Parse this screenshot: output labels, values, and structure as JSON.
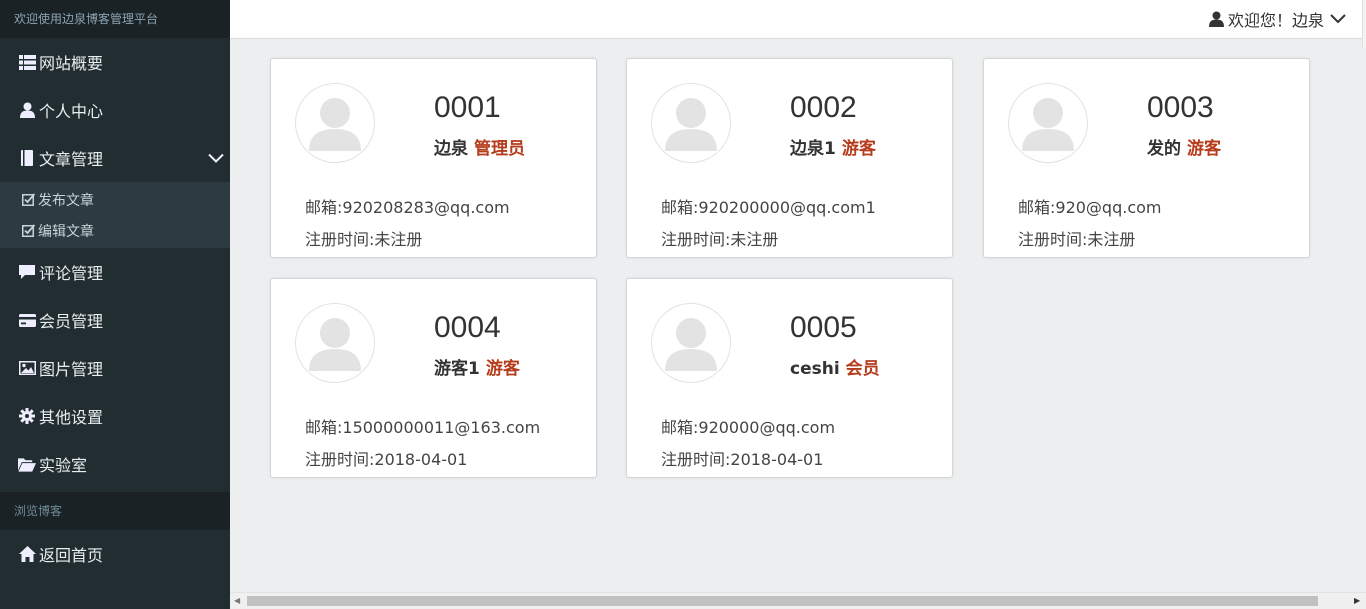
{
  "sidebar": {
    "header": "欢迎使用边泉博客管理平台",
    "items": [
      {
        "label": "网站概要",
        "icon": "list-icon"
      },
      {
        "label": "个人中心",
        "icon": "user-icon"
      },
      {
        "label": "文章管理",
        "icon": "book-icon"
      },
      {
        "label": "评论管理",
        "icon": "comment-icon"
      },
      {
        "label": "会员管理",
        "icon": "card-icon"
      },
      {
        "label": "图片管理",
        "icon": "picture-icon"
      },
      {
        "label": "其他设置",
        "icon": "gear-icon"
      },
      {
        "label": "实验室",
        "icon": "folder-open-icon"
      }
    ],
    "submenu": [
      {
        "label": "发布文章",
        "icon": "edit-icon"
      },
      {
        "label": "编辑文章",
        "icon": "edit-icon"
      }
    ],
    "section_header": "浏览博客",
    "bottom_item": {
      "label": "返回首页",
      "icon": "home-icon"
    }
  },
  "topbar": {
    "welcome": "欢迎您！边泉"
  },
  "cards": [
    {
      "id": "0001",
      "name": "边泉",
      "role": "管理员",
      "email": "邮箱:920208283@qq.com",
      "reg": "注册时间:未注册"
    },
    {
      "id": "0002",
      "name": "边泉1",
      "role": "游客",
      "email": "邮箱:920200000@qq.com1",
      "reg": "注册时间:未注册"
    },
    {
      "id": "0003",
      "name": "发的",
      "role": "游客",
      "email": "邮箱:920@qq.com",
      "reg": "注册时间:未注册"
    },
    {
      "id": "0004",
      "name": "游客1",
      "role": "游客",
      "email": "邮箱:15000000011@163.com",
      "reg": "注册时间:2018-04-01"
    },
    {
      "id": "0005",
      "name": "ceshi",
      "role": "会员",
      "email": "邮箱:920000@qq.com",
      "reg": "注册时间:2018-04-01"
    }
  ],
  "colors": {
    "sidebar_bg": "#222d32",
    "role_accent": "#b53b1b",
    "content_bg": "#eceeef"
  }
}
